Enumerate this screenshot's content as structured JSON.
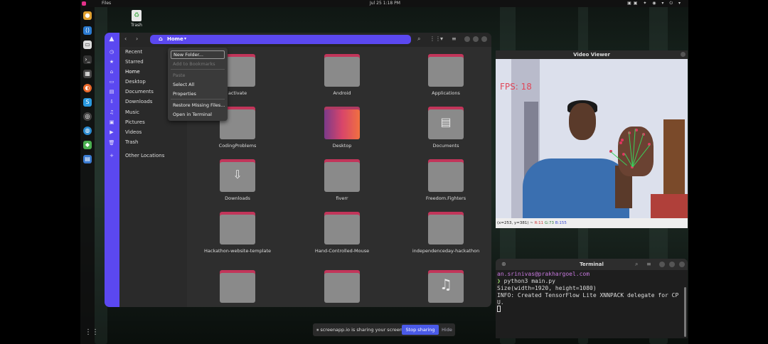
{
  "topbar": {
    "app_menu": "Files",
    "clock": "Jul 25  1:18 PM"
  },
  "desktop": {
    "trash_label": "Trash"
  },
  "files": {
    "path_label": "Home",
    "places": [
      {
        "label": "Recent"
      },
      {
        "label": "Starred"
      },
      {
        "label": "Home"
      },
      {
        "label": "Desktop"
      },
      {
        "label": "Documents"
      },
      {
        "label": "Downloads"
      },
      {
        "label": "Music"
      },
      {
        "label": "Pictures"
      },
      {
        "label": "Videos"
      },
      {
        "label": "Trash"
      },
      {
        "label": "Other Locations"
      }
    ],
    "folders": [
      {
        "name": "activate"
      },
      {
        "name": "Android"
      },
      {
        "name": "Applications"
      },
      {
        "name": "CodingProblems"
      },
      {
        "name": "Desktop"
      },
      {
        "name": "Documents"
      },
      {
        "name": "Downloads"
      },
      {
        "name": "fiverr"
      },
      {
        "name": "Freedom.Fighters"
      },
      {
        "name": "Hackathon-website-template"
      },
      {
        "name": "Hand-Controlled-Mouse"
      },
      {
        "name": "independenceday-hackathon"
      },
      {
        "name": ""
      },
      {
        "name": ""
      },
      {
        "name": ""
      }
    ],
    "context_menu": {
      "new_folder": "New Folder...",
      "add_bookmarks": "Add to Bookmarks",
      "paste": "Paste",
      "select_all": "Select All",
      "properties": "Properties",
      "restore_missing": "Restore Missing Files...",
      "open_terminal": "Open in Terminal"
    }
  },
  "video_viewer": {
    "title": "Video Viewer",
    "fps_text": "FPS: 18",
    "status": {
      "coords": "(x=253, y=381) ~",
      "r": "R:11",
      "g": "G:73",
      "b": "B:155"
    }
  },
  "terminal": {
    "title": "Terminal",
    "lines": {
      "user": "an.srinivas@prakhargoel.com",
      "cmd": "python3 main.py",
      "out1": "Size(width=1920, height=1080)",
      "out2": "INFO: Created TensorFlow Lite XNNPACK delegate for CP",
      "out3": "U."
    }
  },
  "share_banner": {
    "message": "screenapp.io is sharing your screen.",
    "stop_label": "Stop sharing",
    "hide_label": "Hide"
  },
  "colors": {
    "accent": "#5b48f0",
    "folder_tab": "#c2355a",
    "folder_body": "#8a8a8a"
  }
}
